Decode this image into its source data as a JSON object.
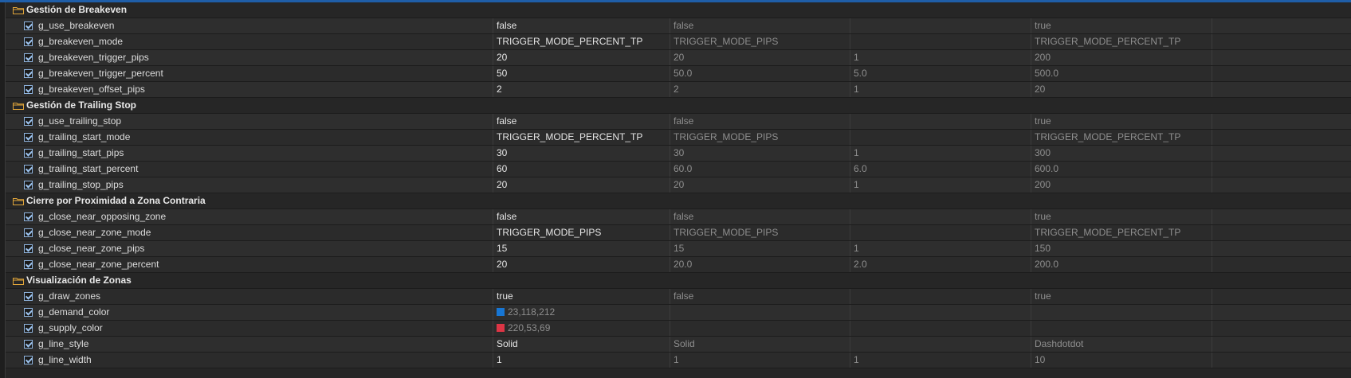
{
  "groups": [
    {
      "title": "Gestión de Breakeven",
      "params": [
        {
          "name": "g_use_breakeven",
          "value": "false",
          "start": "false",
          "step": "",
          "stop": "true"
        },
        {
          "name": "g_breakeven_mode",
          "value": "TRIGGER_MODE_PERCENT_TP",
          "start": "TRIGGER_MODE_PIPS",
          "step": "",
          "stop": "TRIGGER_MODE_PERCENT_TP"
        },
        {
          "name": "g_breakeven_trigger_pips",
          "value": "20",
          "start": "20",
          "step": "1",
          "stop": "200"
        },
        {
          "name": "g_breakeven_trigger_percent",
          "value": "50",
          "start": "50.0",
          "step": "5.0",
          "stop": "500.0"
        },
        {
          "name": "g_breakeven_offset_pips",
          "value": "2",
          "start": "2",
          "step": "1",
          "stop": "20"
        }
      ]
    },
    {
      "title": "Gestión de Trailing Stop",
      "params": [
        {
          "name": "g_use_trailing_stop",
          "value": "false",
          "start": "false",
          "step": "",
          "stop": "true"
        },
        {
          "name": "g_trailing_start_mode",
          "value": "TRIGGER_MODE_PERCENT_TP",
          "start": "TRIGGER_MODE_PIPS",
          "step": "",
          "stop": "TRIGGER_MODE_PERCENT_TP"
        },
        {
          "name": "g_trailing_start_pips",
          "value": "30",
          "start": "30",
          "step": "1",
          "stop": "300"
        },
        {
          "name": "g_trailing_start_percent",
          "value": "60",
          "start": "60.0",
          "step": "6.0",
          "stop": "600.0"
        },
        {
          "name": "g_trailing_stop_pips",
          "value": "20",
          "start": "20",
          "step": "1",
          "stop": "200"
        }
      ]
    },
    {
      "title": "Cierre por Proximidad a Zona Contraria",
      "params": [
        {
          "name": "g_close_near_opposing_zone",
          "value": "false",
          "start": "false",
          "step": "",
          "stop": "true"
        },
        {
          "name": "g_close_near_zone_mode",
          "value": "TRIGGER_MODE_PIPS",
          "start": "TRIGGER_MODE_PIPS",
          "step": "",
          "stop": "TRIGGER_MODE_PERCENT_TP"
        },
        {
          "name": "g_close_near_zone_pips",
          "value": "15",
          "start": "15",
          "step": "1",
          "stop": "150"
        },
        {
          "name": "g_close_near_zone_percent",
          "value": "20",
          "start": "20.0",
          "step": "2.0",
          "stop": "200.0"
        }
      ]
    },
    {
      "title": "Visualización de Zonas",
      "params": [
        {
          "name": "g_draw_zones",
          "value": "true",
          "start": "false",
          "step": "",
          "stop": "true"
        },
        {
          "name": "g_demand_color",
          "value": "23,118,212",
          "swatch": "#1776d4",
          "start": "",
          "step": "",
          "stop": ""
        },
        {
          "name": "g_supply_color",
          "value": "220,53,69",
          "swatch": "#dc3545",
          "start": "",
          "step": "",
          "stop": ""
        },
        {
          "name": "g_line_style",
          "value": "Solid",
          "start": "Solid",
          "step": "",
          "stop": "Dashdotdot"
        },
        {
          "name": "g_line_width",
          "value": "1",
          "start": "1",
          "step": "1",
          "stop": "10"
        }
      ]
    }
  ]
}
